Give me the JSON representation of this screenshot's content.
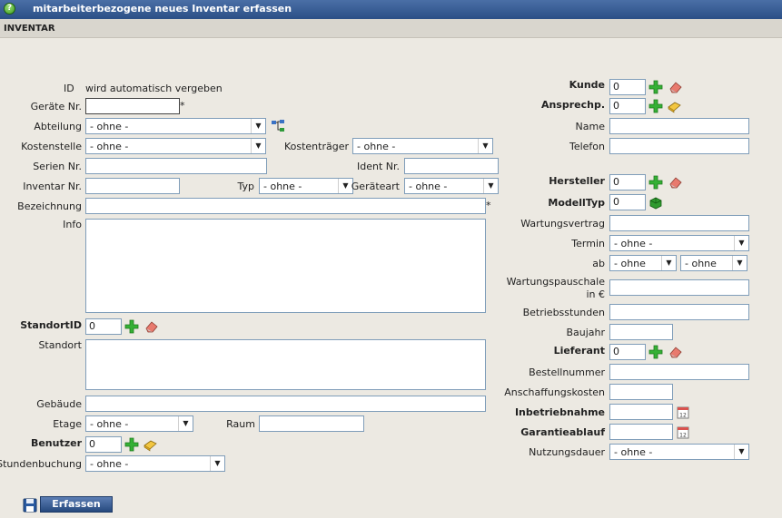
{
  "window": {
    "title": "mitarbeiterbezogene neues Inventar erfassen"
  },
  "section": {
    "title": "INVENTAR"
  },
  "left": {
    "id_label": "ID",
    "id_value": "wird automatisch vergeben",
    "geraete_nr_label": "Geräte Nr.",
    "abteilung_label": "Abteilung",
    "abteilung_value": "- ohne -",
    "kostenstelle_label": "Kostenstelle",
    "kostenstelle_value": "- ohne -",
    "kostentraeger_label": "Kostenträger",
    "kostentraeger_value": "- ohne -",
    "serien_nr_label": "Serien Nr.",
    "ident_nr_label": "Ident Nr.",
    "inventar_nr_label": "Inventar Nr.",
    "typ_label": "Typ",
    "typ_value": "- ohne -",
    "geraeteart_label": "Geräteart",
    "geraeteart_value": "- ohne -",
    "bezeichnung_label": "Bezeichnung",
    "info_label": "Info",
    "standortid_label": "StandortID",
    "standortid_value": "0",
    "standort_label": "Standort",
    "gebaeude_label": "Gebäude",
    "etage_label": "Etage",
    "etage_value": "- ohne -",
    "raum_label": "Raum",
    "benutzer_label": "Benutzer",
    "benutzer_value": "0",
    "stundenbuchung_label": "Stundenbuchung",
    "stundenbuchung_value": "- ohne -",
    "required_mark": "*"
  },
  "right": {
    "kunde_label": "Kunde",
    "kunde_value": "0",
    "ansprechp_label": "Ansprechp.",
    "ansprechp_value": "0",
    "name_label": "Name",
    "telefon_label": "Telefon",
    "hersteller_label": "Hersteller",
    "hersteller_value": "0",
    "modelltyp_label": "ModellTyp",
    "modelltyp_value": "0",
    "wartungsvertrag_label": "Wartungsvertrag",
    "termin_label": "Termin",
    "termin_value": "- ohne -",
    "ab_label": "ab",
    "ab_value1": "- ohne",
    "ab_value2": "- ohne",
    "wartungspauschale_label1": "Wartungspauschale",
    "wartungspauschale_label2": "in €",
    "betriebsstunden_label": "Betriebsstunden",
    "baujahr_label": "Baujahr",
    "lieferant_label": "Lieferant",
    "lieferant_value": "0",
    "bestellnummer_label": "Bestellnummer",
    "anschaffungskosten_label": "Anschaffungskosten",
    "inbetriebnahme_label": "Inbetriebnahme",
    "garantieablauf_label": "Garantieablauf",
    "nutzungsdauer_label": "Nutzungsdauer",
    "nutzungsdauer_value": "- ohne -"
  },
  "footer": {
    "save_label": "Erfassen"
  },
  "colors": {
    "titlebar": "#2b4f86",
    "background": "#ece9e2",
    "input_border": "#7f9db9",
    "add_green": "#2fa82f"
  },
  "icons": [
    "help-icon",
    "add-icon",
    "eraser-icon",
    "book-icon",
    "tree-icon",
    "calendar-icon",
    "save-icon"
  ]
}
